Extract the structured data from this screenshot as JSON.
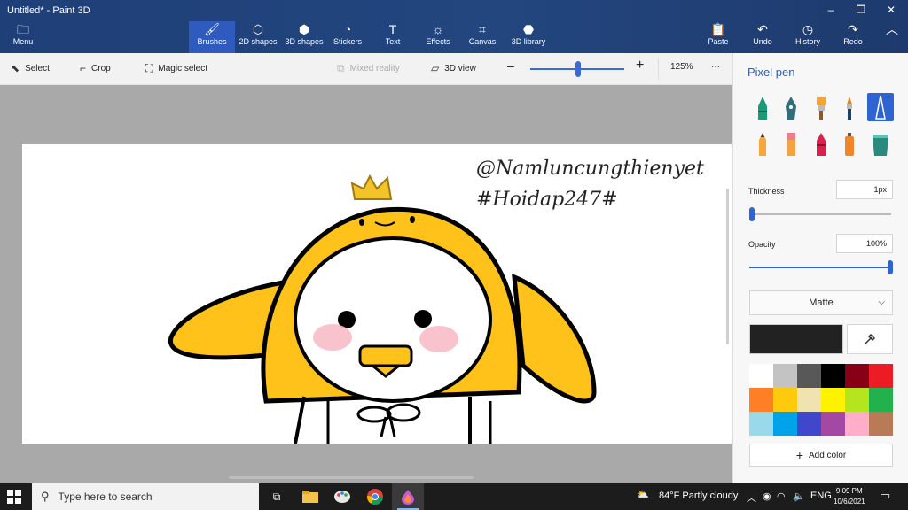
{
  "window": {
    "title": "Untitled* - Paint 3D"
  },
  "ribbon": {
    "menu_label": "Menu",
    "brushes": "Brushes",
    "shapes2d": "2D shapes",
    "shapes3d": "3D shapes",
    "stickers": "Stickers",
    "text": "Text",
    "effects": "Effects",
    "canvas": "Canvas",
    "library3d": "3D library",
    "paste": "Paste",
    "undo": "Undo",
    "history": "History",
    "redo": "Redo"
  },
  "toolbar": {
    "select": "Select",
    "crop": "Crop",
    "magic_select": "Magic select",
    "mixed_reality": "Mixed reality",
    "view3d": "3D view",
    "zoom": "125%",
    "more": "···"
  },
  "canvas": {
    "text_line1": "@Namluncungthienyet",
    "text_line2": "#Hoidap247#"
  },
  "panel": {
    "title": "Pixel pen",
    "thickness_label": "Thickness",
    "thickness_value": "1px",
    "opacity_label": "Opacity",
    "opacity_value": "100%",
    "finish": "Matte",
    "add_color": "Add color",
    "palette": [
      "#ffffff",
      "#c3c3c3",
      "#585858",
      "#000000",
      "#880015",
      "#ed1c24",
      "#ff7f27",
      "#ffc90e",
      "#efe4b0",
      "#fff200",
      "#b5e61d",
      "#22b14c",
      "#99d9ea",
      "#00a2e8",
      "#3f48cc",
      "#a349a4",
      "#ffaec9",
      "#b97a57"
    ]
  },
  "taskbar": {
    "search_placeholder": "Type here to search",
    "weather": "84°F  Partly cloudy",
    "lang": "ENG",
    "time": "9:09 PM",
    "date": "10/6/2021"
  }
}
